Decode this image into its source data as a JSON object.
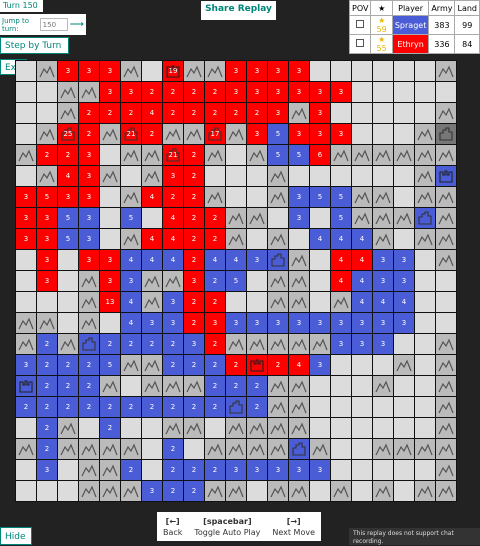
{
  "header": {
    "turn_label": "Turn 150",
    "jump_label": "Jump to turn:",
    "jump_placeholder": "150",
    "jump_go": "⟶",
    "step_label": "Step by Turn",
    "exit_label": "Exit",
    "share_label": "Share Replay"
  },
  "leaderboard": {
    "headers": [
      "POV",
      "★",
      "Player",
      "Army",
      "Land"
    ],
    "rows": [
      {
        "stars": "★ 59",
        "name": "Spraget",
        "army": "383",
        "land": "99",
        "color": "#4a5cd6"
      },
      {
        "stars": "★ 55",
        "name": "Ethryn",
        "army": "336",
        "land": "84",
        "color": "#ff0000"
      }
    ]
  },
  "controls": {
    "back_key": "[←]",
    "back_label": "Back",
    "play_key": "[spacebar]",
    "play_label": "Toggle Auto Play",
    "next_key": "[→]",
    "next_label": "Next Move"
  },
  "hide_label": "Hide",
  "chat_notice": "This replay does not support chat recording.",
  "colors": {
    "red": "#ff0000",
    "blue": "#4a5cd6",
    "empty": "#dcdcdc",
    "mountain": "#bbbbbb",
    "city": "#777777",
    "accent": "#00857a"
  },
  "board": {
    "size": 21,
    "rows": [
      [
        "e",
        "m",
        "r3",
        "r3",
        "r3",
        "m",
        "e",
        "RG19",
        "m",
        "m",
        "r3",
        "r3",
        "r3",
        "r3",
        "e",
        "e",
        "e",
        "e",
        "e",
        "e",
        "m"
      ],
      [
        "e",
        "e",
        "m",
        "m",
        "r3",
        "r3",
        "r2",
        "r2",
        "r2",
        "r2",
        "r3",
        "r3",
        "r3",
        "r3",
        "r3",
        "r3",
        "e",
        "e",
        "e",
        "e",
        "e"
      ],
      [
        "e",
        "e",
        "m",
        "r2",
        "r2",
        "r2",
        "r4",
        "r2",
        "r2",
        "r2",
        "r2",
        "r2",
        "r3",
        "m",
        "r3",
        "e",
        "e",
        "e",
        "e",
        "e",
        "m"
      ],
      [
        "e",
        "m",
        "RC25",
        "r2",
        "m",
        "RC21",
        "r2",
        "m",
        "m",
        "RC17",
        "m",
        "r3",
        "b5",
        "r3",
        "r3",
        "r3",
        "e",
        "e",
        "e",
        "m",
        "c"
      ],
      [
        "m",
        "r2",
        "r2",
        "r3",
        "e",
        "m",
        "m",
        "RC21",
        "r2",
        "m",
        "e",
        "m",
        "b5",
        "b5",
        "r6",
        "m",
        "m",
        "m",
        "m",
        "m",
        "m"
      ],
      [
        "e",
        "m",
        "r4",
        "r3",
        "m",
        "e",
        "m",
        "r3",
        "r2",
        "e",
        "e",
        "e",
        "m",
        "e",
        "e",
        "e",
        "e",
        "e",
        "e",
        "m",
        "BG"
      ],
      [
        "r3",
        "r5",
        "r3",
        "r3",
        "e",
        "m",
        "r4",
        "r2",
        "r2",
        "m",
        "e",
        "e",
        "m",
        "b3",
        "b5",
        "b5",
        "m",
        "m",
        "e",
        "m",
        "m"
      ],
      [
        "r3",
        "r3",
        "b5",
        "b3",
        "e",
        "b5",
        "e",
        "r4",
        "r2",
        "r2",
        "m",
        "m",
        "e",
        "b3",
        "e",
        "b5",
        "m",
        "m",
        "m",
        "BC",
        "m"
      ],
      [
        "r3",
        "r3",
        "b5",
        "b3",
        "e",
        "m",
        "r4",
        "r4",
        "r2",
        "r2",
        "m",
        "e",
        "m",
        "e",
        "b4",
        "b4",
        "b4",
        "m",
        "e",
        "m",
        "m"
      ],
      [
        "e",
        "r3",
        "e",
        "r3",
        "r3",
        "b4",
        "b4",
        "b4",
        "r2",
        "b4",
        "b4",
        "b3",
        "BC",
        "m",
        "e",
        "r4",
        "r4",
        "b3",
        "b3",
        "e",
        "m"
      ],
      [
        "e",
        "r3",
        "e",
        "m",
        "r3",
        "b3",
        "m",
        "m",
        "r3",
        "b2",
        "b5",
        "e",
        "m",
        "m",
        "e",
        "r4",
        "b4",
        "b3",
        "b3",
        "e",
        "e"
      ],
      [
        "e",
        "e",
        "e",
        "m",
        "r13",
        "b4",
        "m",
        "b3",
        "r2",
        "r2",
        "e",
        "e",
        "m",
        "m",
        "e",
        "m",
        "b4",
        "b4",
        "b4",
        "e",
        "e"
      ],
      [
        "m",
        "m",
        "e",
        "m",
        "e",
        "b4",
        "b3",
        "b3",
        "r2",
        "r3",
        "b3",
        "b3",
        "b3",
        "b3",
        "b3",
        "b3",
        "b3",
        "b3",
        "b3",
        "e",
        "e"
      ],
      [
        "m",
        "b2",
        "m",
        "BC",
        "b2",
        "b2",
        "b2",
        "b2",
        "b3",
        "r2",
        "m",
        "m",
        "m",
        "m",
        "m",
        "b3",
        "b3",
        "b3",
        "e",
        "e",
        "m"
      ],
      [
        "b3",
        "b2",
        "b2",
        "b2",
        "b5",
        "m",
        "m",
        "b2",
        "b2",
        "b2",
        "r2",
        "RG",
        "r2",
        "r4",
        "b3",
        "e",
        "e",
        "e",
        "m",
        "e",
        "m"
      ],
      [
        "BG",
        "b2",
        "b2",
        "b2",
        "m",
        "e",
        "m",
        "m",
        "m",
        "b2",
        "b2",
        "b2",
        "m",
        "m",
        "e",
        "e",
        "e",
        "m",
        "e",
        "e",
        "m"
      ],
      [
        "b2",
        "b2",
        "b2",
        "b2",
        "b2",
        "b2",
        "b2",
        "b2",
        "b2",
        "b2",
        "BC",
        "b2",
        "m",
        "m",
        "e",
        "e",
        "e",
        "e",
        "e",
        "e",
        "m"
      ],
      [
        "e",
        "b2",
        "m",
        "e",
        "b2",
        "e",
        "e",
        "m",
        "m",
        "e",
        "m",
        "m",
        "m",
        "m",
        "e",
        "e",
        "e",
        "e",
        "e",
        "e",
        "m"
      ],
      [
        "m",
        "b2",
        "m",
        "m",
        "m",
        "m",
        "e",
        "b2",
        "e",
        "m",
        "m",
        "m",
        "m",
        "BC",
        "m",
        "e",
        "e",
        "m",
        "m",
        "m",
        "m"
      ],
      [
        "e",
        "b3",
        "e",
        "m",
        "m",
        "b2",
        "e",
        "b2",
        "b2",
        "b2",
        "b3",
        "b3",
        "b3",
        "b3",
        "b3",
        "e",
        "e",
        "e",
        "e",
        "e",
        "m"
      ],
      [
        "e",
        "e",
        "e",
        "m",
        "m",
        "m",
        "b3",
        "b2",
        "b2",
        "m",
        "m",
        "e",
        "m",
        "m",
        "e",
        "m",
        "e",
        "m",
        "e",
        "m",
        "m"
      ]
    ]
  }
}
